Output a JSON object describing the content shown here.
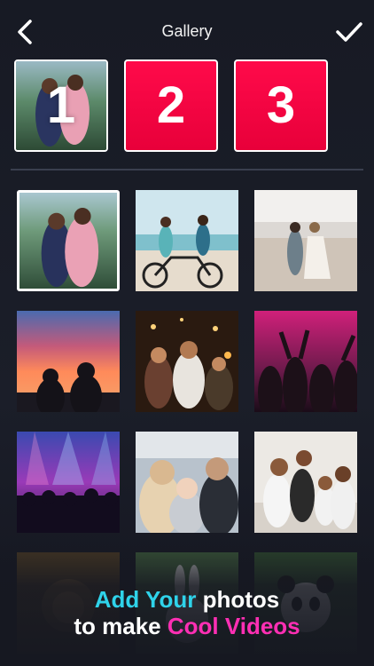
{
  "header": {
    "title": "Gallery",
    "back_icon": "chevron-left-icon",
    "done_icon": "checkmark-icon"
  },
  "slots": [
    {
      "number": "1",
      "state": "filled"
    },
    {
      "number": "2",
      "state": "empty"
    },
    {
      "number": "3",
      "state": "empty"
    }
  ],
  "gallery": {
    "photos": [
      {
        "subject": "couple-portrait-lake",
        "selected": true
      },
      {
        "subject": "couple-bicycle-beach",
        "selected": false
      },
      {
        "subject": "couple-walking-beach",
        "selected": false
      },
      {
        "subject": "couple-sunset-silhouette",
        "selected": false
      },
      {
        "subject": "friends-party-sparklers",
        "selected": false
      },
      {
        "subject": "dance-party-crowd",
        "selected": false
      },
      {
        "subject": "concert-stage-crowd",
        "selected": false
      },
      {
        "subject": "family-with-baby",
        "selected": false
      },
      {
        "subject": "family-group-portrait",
        "selected": false
      },
      {
        "subject": "animal-lion",
        "selected": false
      },
      {
        "subject": "animal-rabbit",
        "selected": false
      },
      {
        "subject": "animal-panda",
        "selected": false
      }
    ]
  },
  "tagline": {
    "line1_highlight": "Add Your",
    "line1_rest": " photos",
    "line2_start": "to make ",
    "line2_highlight": "Cool Videos"
  },
  "colors": {
    "accent_red": "#ff0a4a",
    "highlight_cyan": "#2fd3ea",
    "highlight_pink": "#ff2fb4",
    "background": "#1b1e29"
  }
}
